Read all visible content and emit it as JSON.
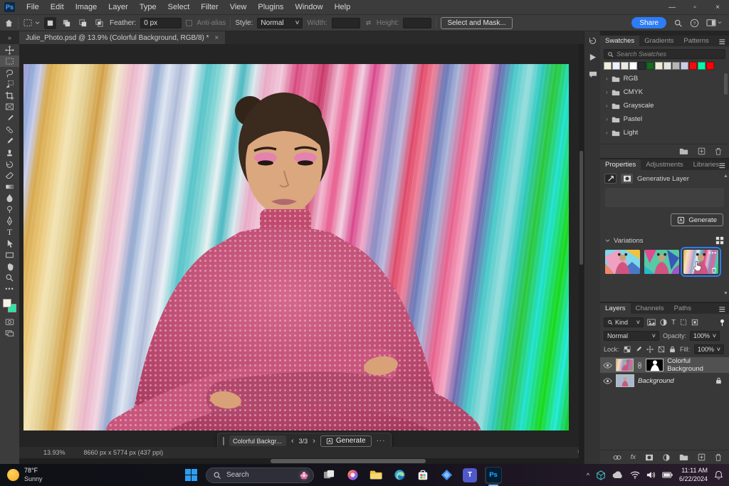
{
  "app": {
    "accent_blue": "#2e7cf6",
    "selection_blue": "#2e7cf6"
  },
  "menu_bar": {
    "items": [
      "File",
      "Edit",
      "Image",
      "Layer",
      "Type",
      "Select",
      "Filter",
      "View",
      "Plugins",
      "Window",
      "Help"
    ]
  },
  "window_controls": {
    "minimize": "—",
    "maximize": "▫",
    "close": "×"
  },
  "glyphs": {
    "ps_logo": "Ps",
    "collapse_chevrons": "»",
    "tab_close": "×",
    "chevron_left": "‹",
    "chevron_right": "›",
    "ellipsis": "···",
    "dots3": "•••",
    "fx": "fx",
    "status_arrow": "›",
    "dropdown": "˅",
    "expand": "›",
    "collapse_down": "˅",
    "tray_chevron": "^"
  },
  "options_bar": {
    "feather_label": "Feather:",
    "feather_value": "0 px",
    "anti_alias_label": "Anti-alias",
    "style_label": "Style:",
    "style_value": "Normal",
    "width_label": "Width:",
    "height_label": "Height:",
    "select_and_mask_label": "Select and Mask...",
    "share_label": "Share"
  },
  "document_tab": {
    "title": "Julie_Photo.psd @ 13.9% (Colorful Background, RGB/8) *"
  },
  "toolbar": {
    "tool_names": [
      "move",
      "rectangular-marquee",
      "lasso",
      "object-selection",
      "crop",
      "frame",
      "eyedropper",
      "spot-healing-brush",
      "brush",
      "clone-stamp",
      "history-brush",
      "eraser",
      "gradient",
      "blur",
      "dodge",
      "pen",
      "type",
      "path-select",
      "rectangle",
      "hand",
      "zoom",
      "edit-toolbar"
    ],
    "foreground_color": "#f5f2e4",
    "background_color": "#27e8a2"
  },
  "canvas": {
    "status_zoom": "13.93%",
    "status_dimensions": "8660 px x 5774 px (437 ppi)"
  },
  "contextual_taskbar": {
    "prompt_value": "Colorful Backgr...",
    "pagination": "3/3",
    "generate_label": "Generate"
  },
  "swatches_panel": {
    "tabs": [
      "Swatches",
      "Gradients",
      "Patterns"
    ],
    "search_placeholder": "Search Swatches",
    "colors": [
      "#f2eedc",
      "#edf2fb",
      "#e9eae3",
      "#fdfdfd",
      "#2a2d2e",
      "#166a21",
      "#f0ead9",
      "#e5e5e1",
      "#b5b7b4",
      "#cacee5",
      "#f20d0c",
      "#0cf2a9",
      "#fb0206"
    ],
    "groups": [
      "RGB",
      "CMYK",
      "Grayscale",
      "Pastel",
      "Light"
    ]
  },
  "properties_panel": {
    "tabs": [
      "Properties",
      "Adjustments",
      "Libraries"
    ],
    "layer_label": "Generative Layer",
    "generate_label": "Generate",
    "variations_label": "Variations",
    "variations_count": 3,
    "selected_variation_index": 3
  },
  "layers_panel": {
    "tabs": [
      "Layers",
      "Channels",
      "Paths"
    ],
    "filter_label": "Kind",
    "blend_mode": "Normal",
    "opacity_label": "Opacity:",
    "opacity_value": "100%",
    "lock_label": "Lock:",
    "fill_label": "Fill:",
    "fill_value": "100%",
    "layers": [
      {
        "name": "Colorful Background"
      },
      {
        "name": "Background"
      }
    ]
  },
  "taskbar": {
    "weather_temp": "78°F",
    "weather_desc": "Sunny",
    "search_placeholder": "Search",
    "time": "11:11 AM",
    "date": "6/22/2024"
  }
}
